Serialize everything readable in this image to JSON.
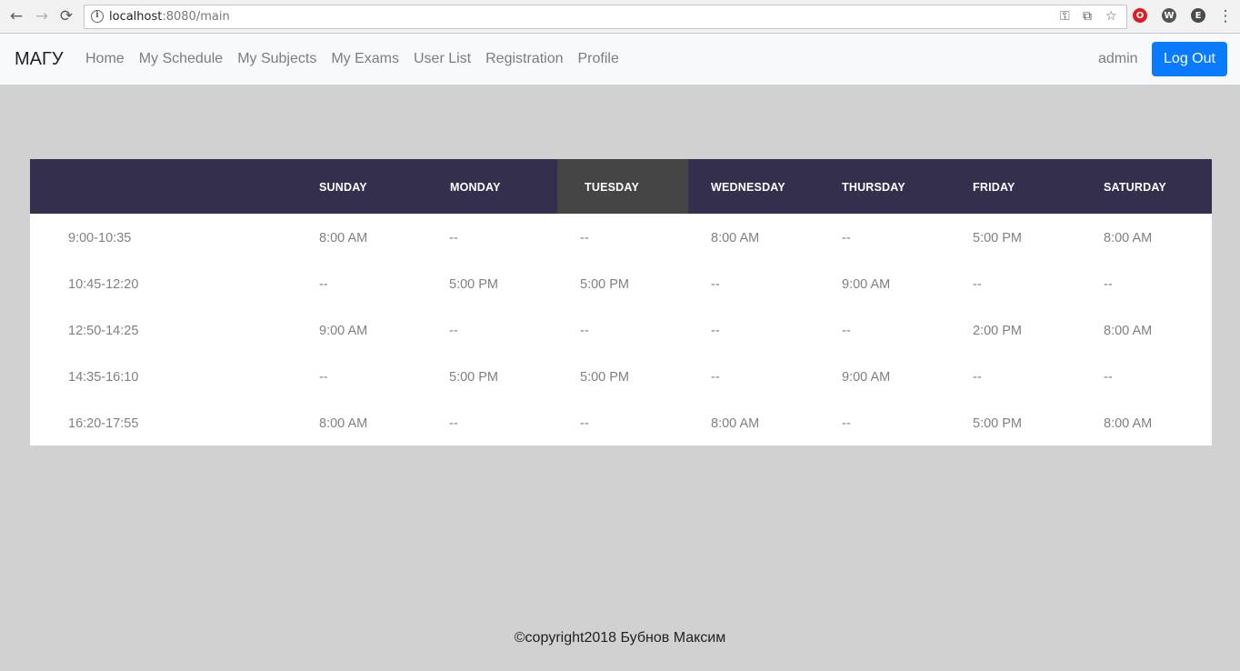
{
  "browser": {
    "url_host": "localhost",
    "url_rest": ":8080/main",
    "back_icon": "←",
    "forward_icon": "→",
    "reload_icon": "⟳"
  },
  "navbar": {
    "brand": "МАГУ",
    "links": [
      "Home",
      "My Schedule",
      "My Subjects",
      "My Exams",
      "User List",
      "Registration",
      "Profile"
    ],
    "user": "admin",
    "logout": "Log Out"
  },
  "schedule": {
    "days": [
      "SUNDAY",
      "MONDAY",
      "TUESDAY",
      "WEDNESDAY",
      "THURSDAY",
      "FRIDAY",
      "SATURDAY"
    ],
    "active_day": "TUESDAY",
    "rows": [
      {
        "time": "9:00-10:35",
        "cells": [
          "8:00 AM",
          "--",
          "--",
          "8:00 AM",
          "--",
          "5:00 PM",
          "8:00 AM"
        ]
      },
      {
        "time": "10:45-12:20",
        "cells": [
          "--",
          "5:00 PM",
          "5:00 PM",
          "--",
          "9:00 AM",
          "--",
          "--"
        ]
      },
      {
        "time": "12:50-14:25",
        "cells": [
          "9:00 AM",
          "--",
          "--",
          "--",
          "--",
          "2:00 PM",
          "8:00 AM"
        ]
      },
      {
        "time": "14:35-16:10",
        "cells": [
          "--",
          "5:00 PM",
          "5:00 PM",
          "--",
          "9:00 AM",
          "--",
          "--"
        ]
      },
      {
        "time": "16:20-17:55",
        "cells": [
          "8:00 AM",
          "--",
          "--",
          "8:00 AM",
          "--",
          "5:00 PM",
          "8:00 AM"
        ]
      }
    ]
  },
  "footer": "©copyright2018 Бубнов Максим",
  "colors": {
    "header_bg": "#342f4c",
    "active_day_bg": "#454545",
    "page_bg": "#d1d1d1",
    "logout_bg": "#0a7bff"
  }
}
